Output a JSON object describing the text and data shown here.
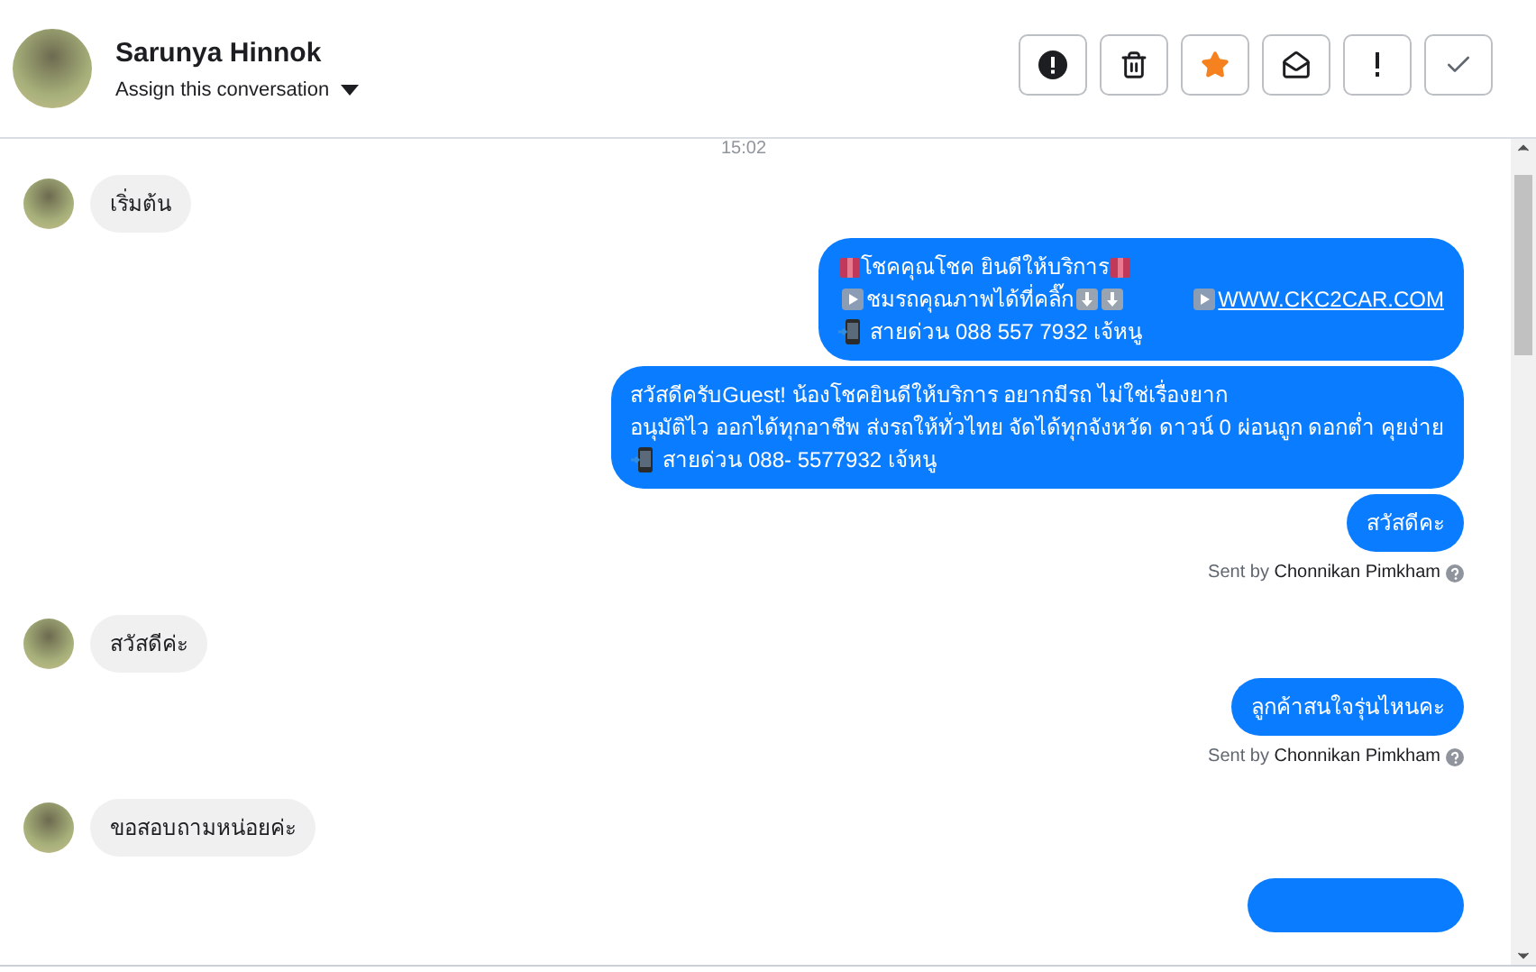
{
  "header": {
    "name": "Sarunya Hinnok",
    "assign_label": "Assign this conversation"
  },
  "toolbar_buttons": [
    {
      "kind": "alert"
    },
    {
      "kind": "trash"
    },
    {
      "kind": "star"
    },
    {
      "kind": "mail"
    },
    {
      "kind": "exclaim"
    },
    {
      "kind": "check"
    }
  ],
  "timestamp": "15:02",
  "messages": [
    {
      "kind": "incoming",
      "lines": [
        [
          {
            "kind": "text",
            "text": "เริ่มต้น"
          }
        ]
      ]
    },
    {
      "kind": "outgoing",
      "lines": [
        [
          {
            "kind": "gift"
          },
          {
            "kind": "text",
            "text": "โชคคุณโชค ยินดีให้บริการ"
          },
          {
            "kind": "gift"
          }
        ],
        [
          {
            "kind": "play"
          },
          {
            "kind": "text",
            "text": "ชมรถคุณภาพได้ที่คลิ๊ก"
          },
          {
            "kind": "down"
          },
          {
            "kind": "down"
          },
          {
            "kind": "gap"
          },
          {
            "kind": "play"
          },
          {
            "kind": "link",
            "text": "WWW.CKC2CAR.COM"
          }
        ],
        [
          {
            "kind": "phone"
          },
          {
            "kind": "text",
            "text": "สายด่วน 088 557 7932 เจ้หนู"
          }
        ]
      ]
    },
    {
      "kind": "outgoing",
      "lines": [
        [
          {
            "kind": "text",
            "text": "สวัสดีครับGuest! น้องโชคยินดีให้บริการ อยากมีรถ ไม่ใช่เรื่องยาก"
          }
        ],
        [
          {
            "kind": "text",
            "text": "อนุมัติไว ออกได้ทุกอาชีพ ส่งรถให้ทั่วไทย จัดได้ทุกจังหวัด ดาวน์ 0  ผ่อนถูก ดอกต่ำ คุยง่าย"
          }
        ],
        [
          {
            "kind": "phone"
          },
          {
            "kind": "text",
            "text": "สายด่วน 088- 5577932 เจ้หนู"
          }
        ]
      ]
    },
    {
      "kind": "outgoing",
      "lines": [
        [
          {
            "kind": "text",
            "text": "สวัสดีคะ"
          }
        ]
      ],
      "sent_by": "Sent by **Chonnikan Pimkham**"
    },
    {
      "kind": "incoming",
      "lines": [
        [
          {
            "kind": "text",
            "text": "สวัสดีค่ะ"
          }
        ]
      ]
    },
    {
      "kind": "outgoing",
      "lines": [
        [
          {
            "kind": "text",
            "text": "ลูกค้าสนใจรุ่นไหนคะ"
          }
        ]
      ],
      "sent_by": "Sent by **Chonnikan Pimkham**"
    },
    {
      "kind": "incoming",
      "lines": [
        [
          {
            "kind": "text",
            "text": "ขอสอบถามหน่อยค่ะ"
          }
        ]
      ]
    }
  ]
}
